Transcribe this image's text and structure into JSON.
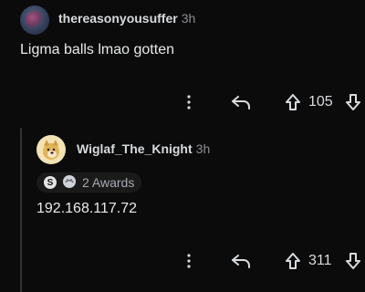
{
  "comment1": {
    "username": "thereasonyousuffer",
    "time": "3h",
    "text": "Ligma balls lmao gotten",
    "votes": "105"
  },
  "comment2": {
    "username": "Wiglaf_The_Knight",
    "time": "3h",
    "awards": {
      "coin_label": "S",
      "count_label": "2 Awards"
    },
    "text": "192.168.117.72",
    "votes": "311"
  },
  "icons": {
    "more": "more-vertical-icon",
    "reply": "reply-arrow-icon",
    "upvote": "upvote-arrow-icon",
    "downvote": "downvote-arrow-icon"
  }
}
